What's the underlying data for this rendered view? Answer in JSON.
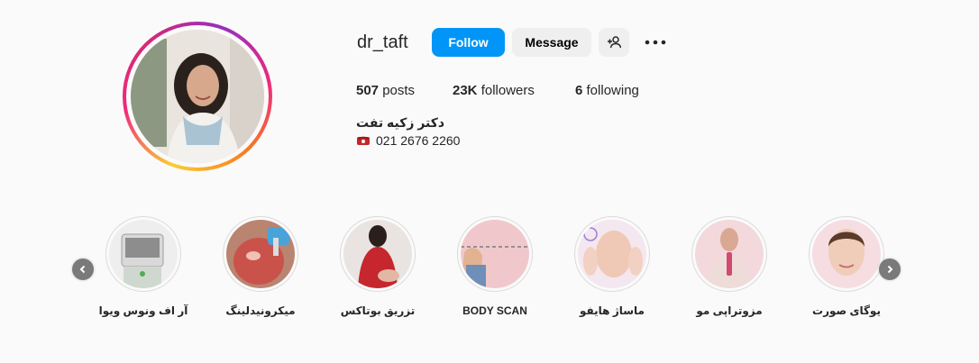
{
  "profile": {
    "username": "dr_taft",
    "follow_label": "Follow",
    "message_label": "Message",
    "posts_count": "507",
    "posts_label": "posts",
    "followers_count": "23K",
    "followers_label": "followers",
    "following_count": "6",
    "following_label": "following",
    "bio_name": "دکتر زکیه تفت",
    "bio_phone": "021 2676 2260"
  },
  "colors": {
    "follow_button": "#0095f6",
    "secondary_button": "#efefef",
    "background": "#fafafa"
  },
  "icons": {
    "suggest": "person-add-icon",
    "more": "more-options-icon",
    "phone": "telephone-icon"
  },
  "highlights": [
    {
      "label": "آر اف ونوس ویوا"
    },
    {
      "label": "میکرونیدلینگ"
    },
    {
      "label": "تزریق بوتاکس"
    },
    {
      "label": "BODY SCAN"
    },
    {
      "label": "ماساژ هایفو"
    },
    {
      "label": "مزوتراپی مو"
    },
    {
      "label": "یوگای صورت"
    }
  ]
}
